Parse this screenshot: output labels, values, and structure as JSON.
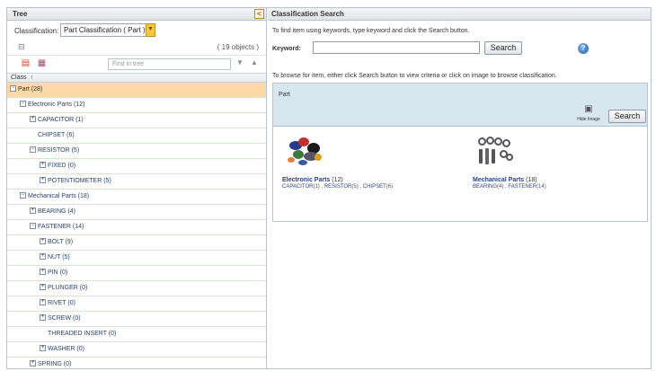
{
  "tree_panel": {
    "title": "Tree",
    "collapse_glyph": "<",
    "classification_label": "Classification:",
    "classification_value": "Part Classification ( Part )",
    "object_count": "( 19 objects )",
    "find_placeholder": "Find in tree",
    "column_header": "Class",
    "column_sort_glyph": "↑",
    "rows": [
      {
        "indent": 0,
        "expander": "−",
        "label": "Part (28)",
        "selected": true
      },
      {
        "indent": 1,
        "expander": "−",
        "label": "Electronic Parts (12)"
      },
      {
        "indent": 2,
        "expander": "+",
        "label": "CAPACITOR (1)"
      },
      {
        "indent": 2,
        "expander": "",
        "label": "CHIPSET (6)"
      },
      {
        "indent": 2,
        "expander": "−",
        "label": "RESISTOR (5)"
      },
      {
        "indent": 3,
        "expander": "+",
        "label": "FIXED (0)"
      },
      {
        "indent": 3,
        "expander": "+",
        "label": "POTENTIOMETER (5)"
      },
      {
        "indent": 1,
        "expander": "−",
        "label": "Mechanical Parts (18)"
      },
      {
        "indent": 2,
        "expander": "+",
        "label": "BEARING (4)"
      },
      {
        "indent": 2,
        "expander": "−",
        "label": "FASTENER (14)"
      },
      {
        "indent": 3,
        "expander": "+",
        "label": "BOLT (9)"
      },
      {
        "indent": 3,
        "expander": "+",
        "label": "NUT (5)"
      },
      {
        "indent": 3,
        "expander": "+",
        "label": "PIN (0)"
      },
      {
        "indent": 3,
        "expander": "+",
        "label": "PLUNGER (0)"
      },
      {
        "indent": 3,
        "expander": "+",
        "label": "RIVET (0)"
      },
      {
        "indent": 3,
        "expander": "+",
        "label": "SCREW (0)"
      },
      {
        "indent": 3,
        "expander": "",
        "label": "THREADED INSERT (0)"
      },
      {
        "indent": 3,
        "expander": "+",
        "label": "WASHER (0)"
      },
      {
        "indent": 2,
        "expander": "+",
        "label": "SPRING (0)"
      }
    ]
  },
  "search_panel": {
    "title": "Classification Search",
    "hint_keywords": "To find item using keywords, type keyword and click the Search button.",
    "keyword_label": "Keyword:",
    "keyword_value": "",
    "search_label": "Search",
    "help_glyph": "?",
    "hint_browse": "To browse for item, either click Search button to view criteria or click on image to browse classification.",
    "browse_title": "Part",
    "hide_image_label": "Hide Image",
    "browse_search_label": "Search",
    "items": [
      {
        "name": "Electronic Parts",
        "count": "(12)",
        "children": [
          {
            "label": "CAPACITOR",
            "count": "(1)"
          },
          {
            "label": "RESISTOR",
            "count": "(5)"
          },
          {
            "label": "CHIPSET",
            "count": "(6)"
          }
        ]
      },
      {
        "name": "Mechanical Parts",
        "count": "(18)",
        "children": [
          {
            "label": "BEARING",
            "count": "(4)"
          },
          {
            "label": "FASTENER",
            "count": "(14)"
          }
        ]
      }
    ]
  }
}
